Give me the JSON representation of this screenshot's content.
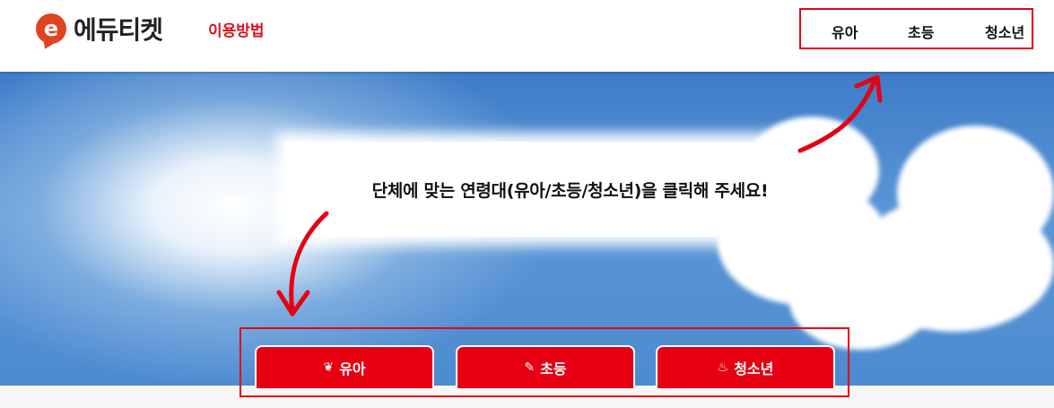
{
  "header": {
    "logo_glyph": "e",
    "logo_text": "에듀티켓",
    "howto_link": "이용방법",
    "nav": [
      {
        "label": "유아"
      },
      {
        "label": "초등"
      },
      {
        "label": "청소년"
      }
    ]
  },
  "hero": {
    "message": "단체에 맞는 연령대(유아/초등/청소년)을 클릭해 주세요!"
  },
  "age_buttons": [
    {
      "label": "유아",
      "icon": "leaf-icon",
      "glyph": "❦"
    },
    {
      "label": "초등",
      "icon": "magic-wand-icon",
      "glyph": "✎"
    },
    {
      "label": "청소년",
      "icon": "fire-icon",
      "glyph": "♨"
    }
  ],
  "colors": {
    "accent_red": "#e60012",
    "howto_red": "#d8111c",
    "logo_orange": "#e2431f",
    "sky_blue": "#4d8bd0"
  }
}
